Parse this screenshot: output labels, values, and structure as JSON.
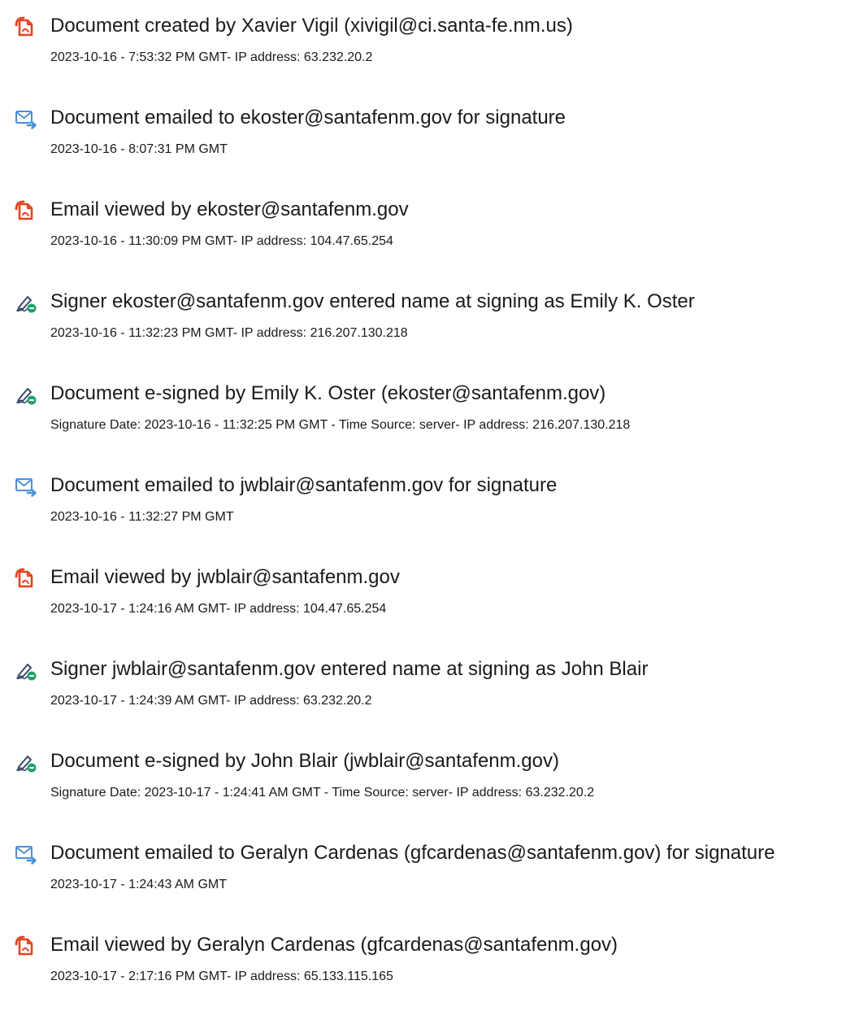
{
  "colors": {
    "pdf_icon": "#e6431f",
    "mail_icon_fill": "#ffffff",
    "mail_icon_stroke": "#4a90d9",
    "sign_icon": "#3a4a6b",
    "sign_badge": "#22a06b"
  },
  "entries": [
    {
      "icon": "document-icon",
      "title": "Document created by Xavier Vigil (xivigil@ci.santa-fe.nm.us)",
      "detail": "2023-10-16 - 7:53:32 PM GMT- IP address: 63.232.20.2"
    },
    {
      "icon": "email-icon",
      "title": "Document emailed to ekoster@santafenm.gov for signature",
      "detail": "2023-10-16 - 8:07:31 PM GMT"
    },
    {
      "icon": "document-icon",
      "title": "Email viewed by ekoster@santafenm.gov",
      "detail": "2023-10-16 - 11:30:09 PM GMT- IP address: 104.47.65.254"
    },
    {
      "icon": "signature-icon",
      "title": "Signer ekoster@santafenm.gov entered name at signing as Emily K. Oster",
      "detail": "2023-10-16 - 11:32:23 PM GMT- IP address: 216.207.130.218"
    },
    {
      "icon": "signature-icon",
      "title": "Document e-signed by Emily K. Oster (ekoster@santafenm.gov)",
      "detail": "Signature Date: 2023-10-16 - 11:32:25 PM GMT - Time Source: server- IP address: 216.207.130.218"
    },
    {
      "icon": "email-icon",
      "title": "Document emailed to jwblair@santafenm.gov for signature",
      "detail": "2023-10-16 - 11:32:27 PM GMT"
    },
    {
      "icon": "document-icon",
      "title": "Email viewed by jwblair@santafenm.gov",
      "detail": "2023-10-17 - 1:24:16 AM GMT- IP address: 104.47.65.254"
    },
    {
      "icon": "signature-icon",
      "title": "Signer jwblair@santafenm.gov entered name at signing as John Blair",
      "detail": "2023-10-17 - 1:24:39 AM GMT- IP address: 63.232.20.2"
    },
    {
      "icon": "signature-icon",
      "title": "Document e-signed by John Blair (jwblair@santafenm.gov)",
      "detail": "Signature Date: 2023-10-17 - 1:24:41 AM GMT - Time Source: server- IP address: 63.232.20.2"
    },
    {
      "icon": "email-icon",
      "title": "Document emailed to Geralyn Cardenas (gfcardenas@santafenm.gov) for signature",
      "detail": "2023-10-17 - 1:24:43 AM GMT"
    },
    {
      "icon": "document-icon",
      "title": "Email viewed by Geralyn Cardenas (gfcardenas@santafenm.gov)",
      "detail": "2023-10-17 - 2:17:16 PM GMT- IP address: 65.133.115.165"
    }
  ]
}
